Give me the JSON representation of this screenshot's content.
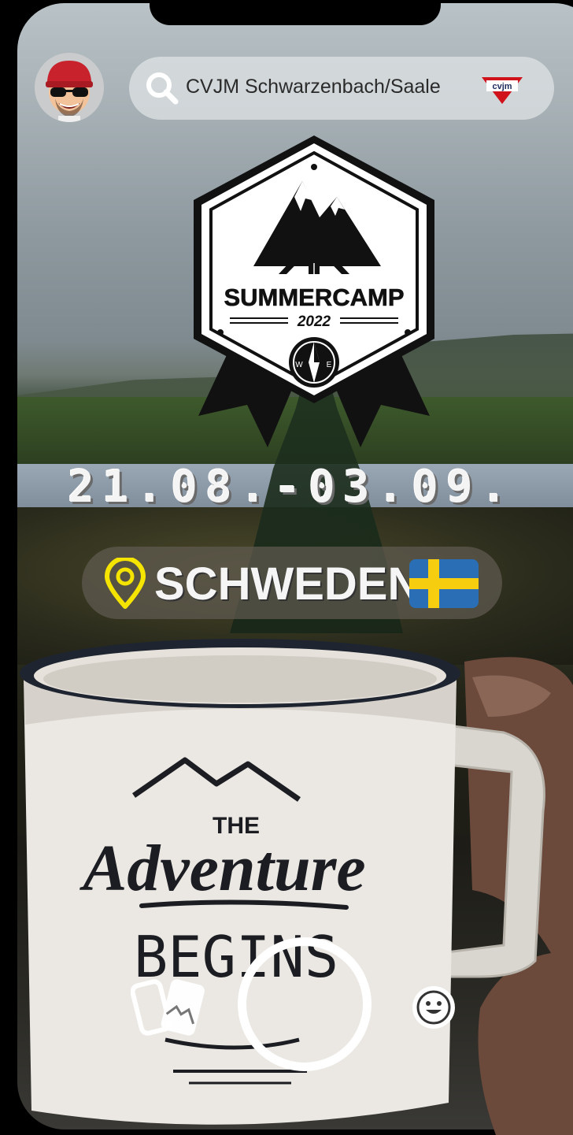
{
  "search": {
    "label": "CVJM Schwarzenbach/Saale",
    "logo_text": "cvjm"
  },
  "badge": {
    "title": "SUMMERCAMP",
    "year": "2022",
    "compass_w": "W",
    "compass_e": "E"
  },
  "event": {
    "dates": "21.08.-03.09."
  },
  "location": {
    "name": "SCHWEDEN"
  },
  "mug": {
    "line1": "THE",
    "line2": "Adventure",
    "line3": "BEGINS"
  },
  "icons": {
    "avatar": "bitmoji-avatar",
    "search": "search-icon",
    "location_pin": "location-pin-icon",
    "flag": "sweden-flag",
    "memories": "memories-icon",
    "shutter": "shutter-button",
    "lens": "smiley-lens-icon"
  },
  "colors": {
    "pin": "#f5e400",
    "flag_blue": "#2a6fb5",
    "flag_yellow": "#f6cd0f"
  }
}
